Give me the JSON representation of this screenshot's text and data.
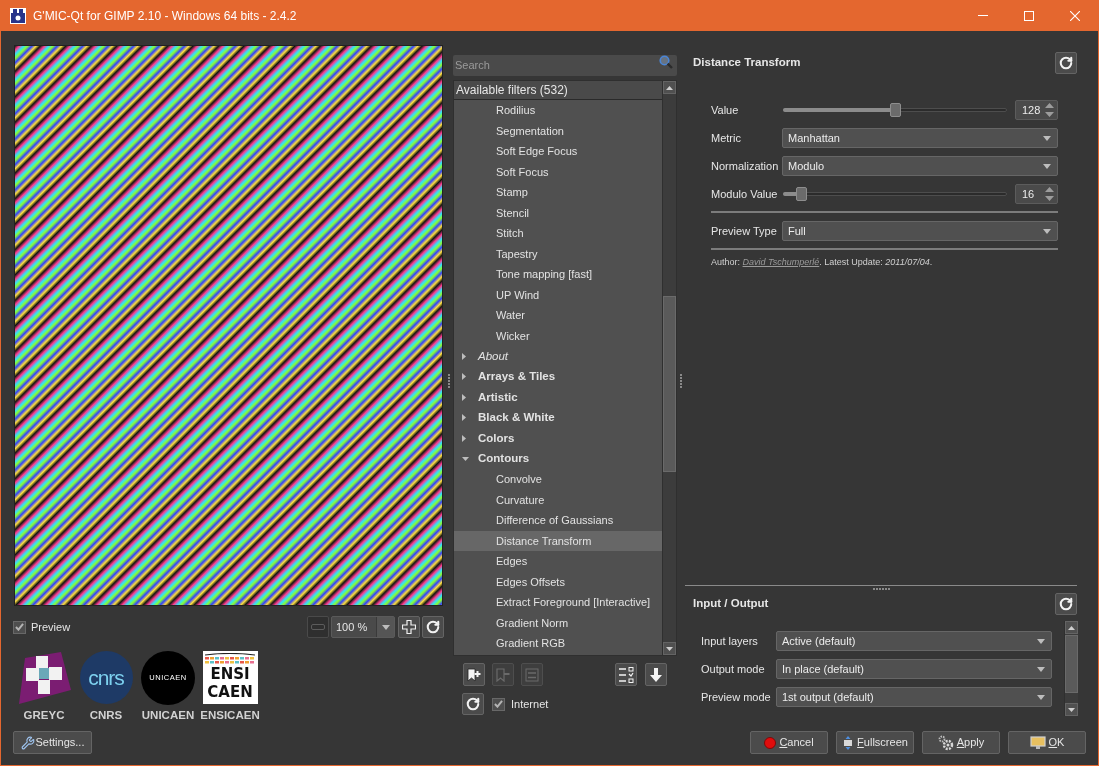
{
  "window": {
    "title": "G'MIC-Qt for GIMP 2.10 - Windows 64 bits - 2.4.2"
  },
  "preview": {
    "label": "Preview",
    "checked": true
  },
  "zoom": {
    "value": "100 %",
    "zoom_out": {
      "disabled": true
    }
  },
  "logos": [
    {
      "kind": "greyc",
      "caption": "GREYC"
    },
    {
      "kind": "cnrs",
      "caption": "CNRS",
      "text": "cnrs"
    },
    {
      "kind": "unicaen",
      "caption": "UNICAEN",
      "text": "UNICAEN"
    },
    {
      "kind": "ensicaen",
      "caption": "ENSICAEN",
      "lines": [
        "ENSI",
        "CAEN"
      ]
    }
  ],
  "settings_button": {
    "label": "Settings..."
  },
  "filters": {
    "search_placeholder": "Search",
    "header": "Available filters (532)",
    "items": [
      {
        "label": "Rodilius",
        "selected": false
      },
      {
        "label": "Segmentation",
        "selected": false
      },
      {
        "label": "Soft Edge Focus",
        "selected": false
      },
      {
        "label": "Soft Focus",
        "selected": false
      },
      {
        "label": "Stamp",
        "selected": false
      },
      {
        "label": "Stencil",
        "selected": false
      },
      {
        "label": "Stitch",
        "selected": false
      },
      {
        "label": "Tapestry",
        "selected": false
      },
      {
        "label": "Tone mapping [fast]",
        "selected": false
      },
      {
        "label": "UP Wind",
        "selected": false
      },
      {
        "label": "Water",
        "selected": false
      },
      {
        "label": "Wicker",
        "selected": false
      }
    ],
    "categories": [
      {
        "label": "About",
        "kind": "info",
        "expanded": false
      },
      {
        "label": "Arrays & Tiles",
        "kind": "folder",
        "expanded": false
      },
      {
        "label": "Artistic",
        "kind": "folder",
        "expanded": false
      },
      {
        "label": "Black & White",
        "kind": "folder",
        "expanded": false
      },
      {
        "label": "Colors",
        "kind": "folder",
        "expanded": false
      },
      {
        "label": "Contours",
        "kind": "folder",
        "expanded": true,
        "children": [
          {
            "label": "Convolve",
            "selected": false
          },
          {
            "label": "Curvature",
            "selected": false
          },
          {
            "label": "Difference of Gaussians",
            "selected": false
          },
          {
            "label": "Distance Transform",
            "selected": true
          },
          {
            "label": "Edges",
            "selected": false
          },
          {
            "label": "Edges Offsets",
            "selected": false
          },
          {
            "label": "Extract Foreground [Interactive]",
            "selected": false
          },
          {
            "label": "Gradient Norm",
            "selected": false
          },
          {
            "label": "Gradient RGB",
            "selected": false
          }
        ]
      }
    ]
  },
  "filter_tools_left": [
    {
      "kind": "add",
      "disabled": false
    },
    {
      "kind": "remove",
      "disabled": true
    },
    {
      "kind": "rename",
      "disabled": true
    }
  ],
  "filter_tools_right": [
    {
      "kind": "visibility",
      "disabled": false
    },
    {
      "kind": "download",
      "disabled": false
    }
  ],
  "internet": {
    "label": "Internet",
    "checked": true
  },
  "filter": {
    "title": "Distance Transform",
    "parameters": [
      {
        "kind": "slider",
        "label": "Value",
        "level": 0.5,
        "value": "128"
      },
      {
        "kind": "select",
        "label": "Metric",
        "value": "Manhattan"
      },
      {
        "kind": "select",
        "label": "Normalization",
        "value": "Modulo"
      },
      {
        "kind": "slider",
        "label": "Modulo Value",
        "level": 0.06,
        "value": "16"
      },
      {
        "kind": "separator"
      },
      {
        "kind": "select",
        "label": "Preview Type",
        "value": "Full"
      },
      {
        "kind": "separator"
      }
    ],
    "info": {
      "prefix": "Author:",
      "author": "David Tschumperlé",
      "suffix": ". Latest Update: *2011/07/04*."
    }
  },
  "input_output": {
    "title": "Input / Output",
    "rows": [
      {
        "label": "Input layers",
        "value": "Active (default)"
      },
      {
        "label": "Output mode",
        "value": "In place (default)"
      },
      {
        "label": "Preview mode",
        "value": "1st output (default)"
      }
    ]
  },
  "dialog_buttons": [
    {
      "kind": "cancel",
      "label": "Cancel"
    },
    {
      "kind": "fullscreen",
      "label": "Fullscreen"
    },
    {
      "kind": "apply",
      "label": "Apply"
    },
    {
      "kind": "ok",
      "label": "OK"
    }
  ]
}
